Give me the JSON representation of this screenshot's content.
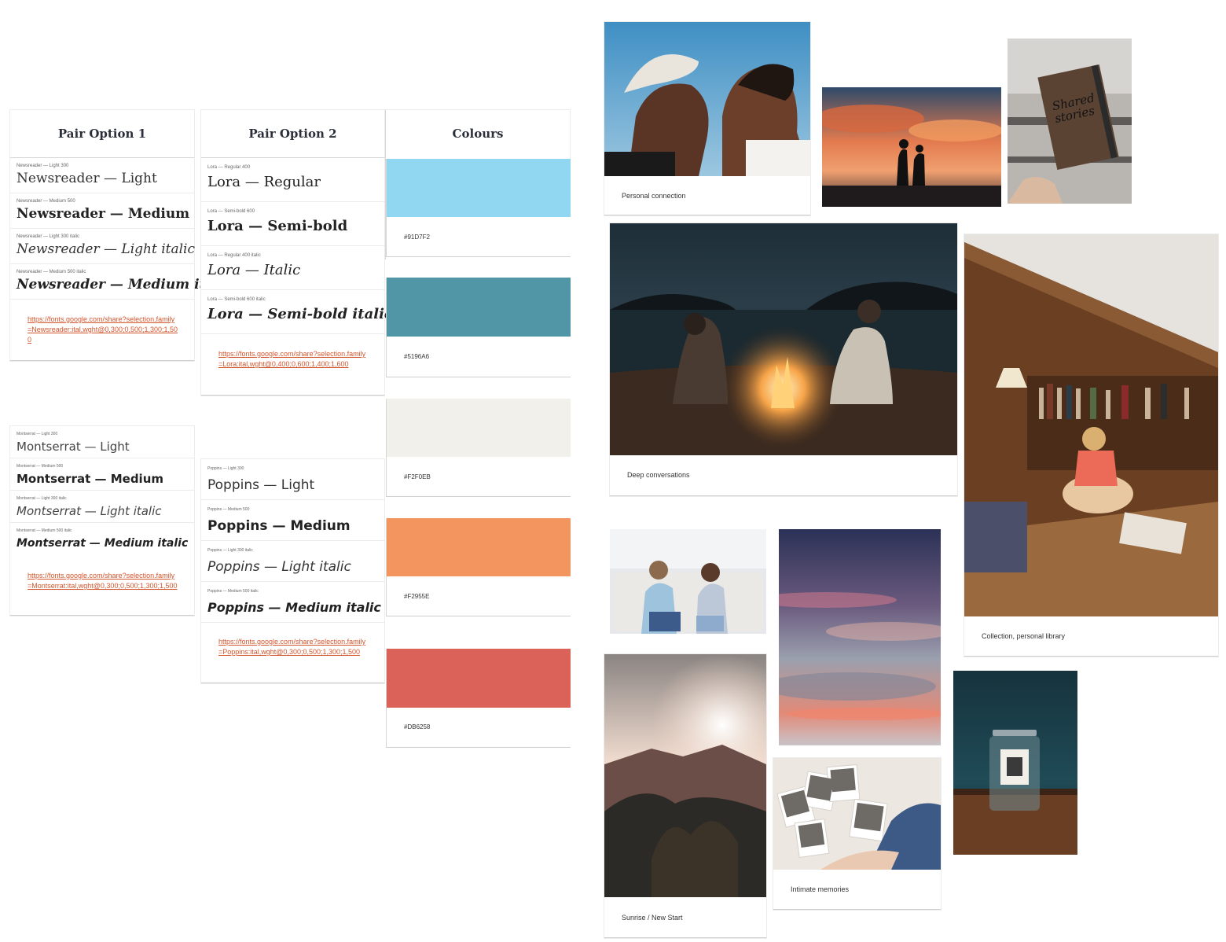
{
  "pair1": {
    "title": "Pair Option 1",
    "serif_rows": [
      {
        "caption": "Newsreader — Light 300",
        "sample": "Newsreader — Light"
      },
      {
        "caption": "Newsreader — Medium 500",
        "sample": "Newsreader — Medium"
      },
      {
        "caption": "Newsreader — Light 300 italic",
        "sample": "Newsreader — Light italic"
      },
      {
        "caption": "Newsreader — Medium 500 italic",
        "sample": "Newsreader — Medium italic"
      }
    ],
    "serif_link": "https://fonts.google.com/share?selection.family=Newsreader:ital,wght@0,300;0,500;1,300;1,500",
    "sans_rows": [
      {
        "caption": "Montserrat — Light 300",
        "sample": "Montserrat — Light"
      },
      {
        "caption": "Montserrat — Medium 500",
        "sample": "Montserrat — Medium"
      },
      {
        "caption": "Montserrat — Light 300 italic",
        "sample": "Montserrat — Light italic"
      },
      {
        "caption": "Montserrat — Medium 500 italic",
        "sample": "Montserrat — Medium italic"
      }
    ],
    "sans_link": "https://fonts.google.com/share?selection.family=Montserrat:ital,wght@0,300;0,500;1,300;1,500"
  },
  "pair2": {
    "title": "Pair Option 2",
    "serif_rows": [
      {
        "caption": "Lora — Regular 400",
        "sample": "Lora — Regular"
      },
      {
        "caption": "Lora — Semi-bold 600",
        "sample": "Lora — Semi-bold"
      },
      {
        "caption": "Lora — Regular 400 italic",
        "sample": "Lora — Italic"
      },
      {
        "caption": "Lora — Semi-bold 600 italic",
        "sample": "Lora — Semi-bold italic"
      }
    ],
    "serif_link": "https://fonts.google.com/share?selection.family=Lora:ital,wght@0,400;0,600;1,400;1,600",
    "sans_rows": [
      {
        "caption": "Poppins — Light 300",
        "sample": "Poppins — Light"
      },
      {
        "caption": "Poppins — Medium 500",
        "sample": "Poppins — Medium"
      },
      {
        "caption": "Poppins — Light 300 italic",
        "sample": "Poppins — Light italic"
      },
      {
        "caption": "Poppins — Medium 500 italic",
        "sample": "Poppins — Medium italic"
      }
    ],
    "sans_link": "https://fonts.google.com/share?selection.family=Poppins:ital,wght@0,300;0,500;1,300;1,500"
  },
  "colours": {
    "title": "Colours",
    "swatches": [
      {
        "hex": "#91D7F2",
        "color": "#91D7F2"
      },
      {
        "hex": "#5196A6",
        "color": "#5196A6"
      },
      {
        "hex": "#F2F0EB",
        "color": "#F2F0EB"
      },
      {
        "hex": "#F2955E",
        "color": "#F2955E"
      },
      {
        "hex": "#DB6258",
        "color": "#DB6258"
      }
    ]
  },
  "moodboard": {
    "captions": {
      "personal_connection": "Personal  connection",
      "deep_conversations": "Deep conversations",
      "collection": "Collection, personal library",
      "sunrise": "Sunrise / New Start",
      "intimate": "Intimate memories"
    },
    "book_text": "Shared stories"
  }
}
